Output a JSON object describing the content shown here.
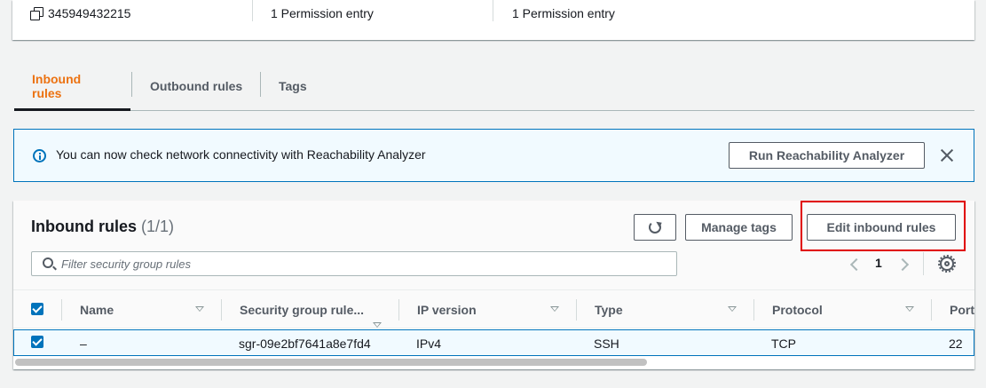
{
  "summary": {
    "security_group_id": "345949432215",
    "inbound_count": "1 Permission entry",
    "outbound_count": "1 Permission entry"
  },
  "tabs": [
    {
      "label": "Inbound rules",
      "active": true
    },
    {
      "label": "Outbound rules",
      "active": false
    },
    {
      "label": "Tags",
      "active": false
    }
  ],
  "flash": {
    "message": "You can now check network connectivity with Reachability Analyzer",
    "action_label": "Run Reachability Analyzer"
  },
  "rules": {
    "title": "Inbound rules",
    "count": "(1/1)",
    "manage_tags_label": "Manage tags",
    "edit_label": "Edit inbound rules",
    "filter_placeholder": "Filter security group rules",
    "page": "1",
    "columns": [
      "Name",
      "Security group rule...",
      "IP version",
      "Type",
      "Protocol",
      "Port"
    ],
    "rows": [
      {
        "name": "–",
        "rule_id": "sgr-09e2bf7641a8e7fd4",
        "ip_version": "IPv4",
        "type": "SSH",
        "protocol": "TCP",
        "port": "22"
      }
    ]
  },
  "colors": {
    "accent": "#ec7211",
    "info": "#0073bb",
    "highlight": "#e00000"
  }
}
